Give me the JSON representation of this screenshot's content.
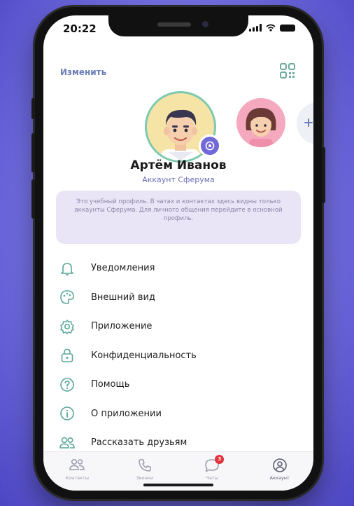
{
  "status": {
    "time": "20:22"
  },
  "header": {
    "edit_label": "Изменить"
  },
  "profile": {
    "name": "Артём Иванов",
    "account_type": "Аккаунт Сферума",
    "info_text": "Это учебный профиль. В чатах и контактах здесь видны только аккаунты Сферума. Для личного общения перейдите в основной профиль."
  },
  "menu": {
    "items": [
      {
        "label": "Уведомления",
        "icon": "bell-icon"
      },
      {
        "label": "Внешний вид",
        "icon": "palette-icon"
      },
      {
        "label": "Приложение",
        "icon": "gear-icon"
      },
      {
        "label": "Конфиденциальность",
        "icon": "lock-icon"
      },
      {
        "label": "Помощь",
        "icon": "question-icon"
      },
      {
        "label": "О приложении",
        "icon": "info-icon"
      },
      {
        "label": "Рассказать друзьям",
        "icon": "people-icon"
      }
    ]
  },
  "tabbar": {
    "tabs": [
      {
        "label": "Контакты",
        "icon": "contacts-icon"
      },
      {
        "label": "Звонки",
        "icon": "phone-icon"
      },
      {
        "label": "Чаты",
        "icon": "chat-icon",
        "badge": "3"
      },
      {
        "label": "Аккаунт",
        "icon": "account-icon",
        "active": true
      }
    ]
  },
  "colors": {
    "accent": "#6c7fb8",
    "info_bg": "#e9e5f7",
    "badge": "#e2343d"
  }
}
